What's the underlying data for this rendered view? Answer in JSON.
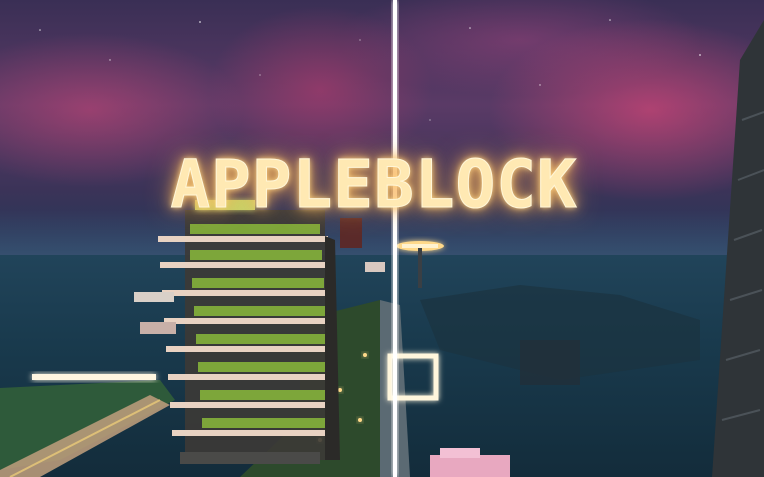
{
  "game": {
    "sign_text": "APPLEBLOCK"
  },
  "colors": {
    "sky_top": "#3a2f55",
    "aurora_pink": "#d24678",
    "sea": "#193a4d",
    "glow_warm": "#ffd98a",
    "beam_white": "#ffffff",
    "tower_floor": "#e8d2c2",
    "crop_green": "#7da63a"
  }
}
